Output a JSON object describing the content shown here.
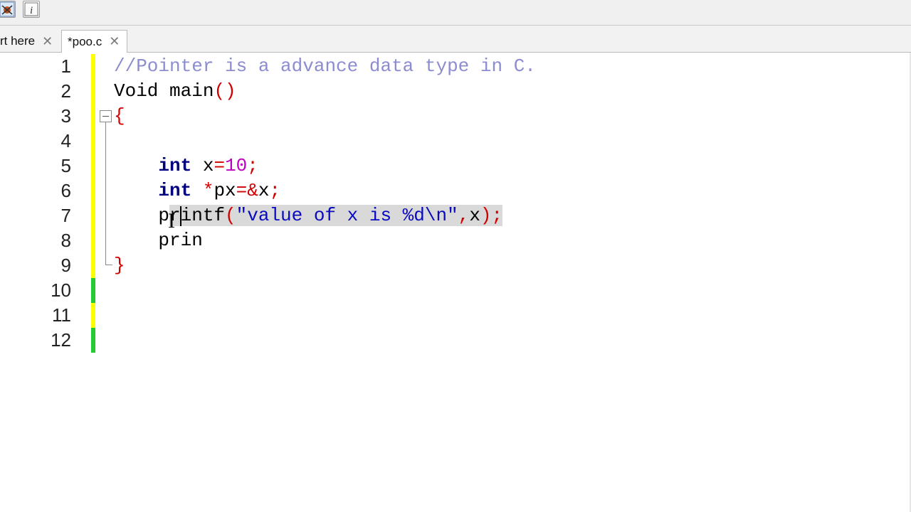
{
  "toolbar": {
    "buttons": [
      {
        "icon": "bug-icon"
      },
      {
        "icon": "info-icon"
      }
    ]
  },
  "tabs": [
    {
      "label": "rt here",
      "close": "✕",
      "active": false
    },
    {
      "label": "*poo.c",
      "close": "✕",
      "active": true
    }
  ],
  "editor": {
    "line_numbers": [
      "1",
      "2",
      "3",
      "4",
      "5",
      "6",
      "7",
      "8",
      "9",
      "10",
      "11",
      "12"
    ],
    "lines": [
      {
        "tokens": [
          {
            "t": "//Pointer is a advance data type in C.",
            "c": "cm"
          }
        ]
      },
      {
        "tokens": [
          {
            "t": "Void main",
            "c": ""
          },
          {
            "t": "()",
            "c": "op"
          }
        ]
      },
      {
        "tokens": [
          {
            "t": "{",
            "c": "op"
          }
        ]
      },
      {
        "tokens": []
      },
      {
        "tokens": [
          {
            "t": "    ",
            "c": ""
          },
          {
            "t": "int",
            "c": "kw"
          },
          {
            "t": " x",
            "c": ""
          },
          {
            "t": "=",
            "c": "op"
          },
          {
            "t": "10",
            "c": "num"
          },
          {
            "t": ";",
            "c": "op"
          }
        ]
      },
      {
        "tokens": [
          {
            "t": "    ",
            "c": ""
          },
          {
            "t": "int",
            "c": "kw"
          },
          {
            "t": " ",
            "c": ""
          },
          {
            "t": "*",
            "c": "op"
          },
          {
            "t": "px",
            "c": ""
          },
          {
            "t": "=&",
            "c": "op"
          },
          {
            "t": "x",
            "c": ""
          },
          {
            "t": ";",
            "c": "op"
          }
        ]
      },
      {
        "tokens": [
          {
            "t": "    p",
            "c": ""
          },
          {
            "t": "rintf",
            "c": "sel"
          },
          {
            "t": "(",
            "c": "op sel"
          },
          {
            "t": "\"value of x is %d\\n\"",
            "c": "str sel"
          },
          {
            "t": ",",
            "c": "op sel"
          },
          {
            "t": "x",
            "c": "sel"
          },
          {
            "t": ");",
            "c": "op sel"
          }
        ]
      },
      {
        "tokens": [
          {
            "t": "    prin",
            "c": ""
          }
        ]
      },
      {
        "tokens": [
          {
            "t": "}",
            "c": "op"
          }
        ]
      },
      {
        "tokens": []
      },
      {
        "tokens": []
      },
      {
        "tokens": []
      }
    ],
    "change_markers": [
      "yellow",
      "yellow",
      "yellow",
      "yellow",
      "yellow",
      "yellow",
      "yellow",
      "yellow",
      "yellow",
      "green",
      "yellow",
      "green"
    ]
  },
  "colors": {
    "yellow_marker": "#ffff00",
    "green_marker": "#22cc33"
  }
}
